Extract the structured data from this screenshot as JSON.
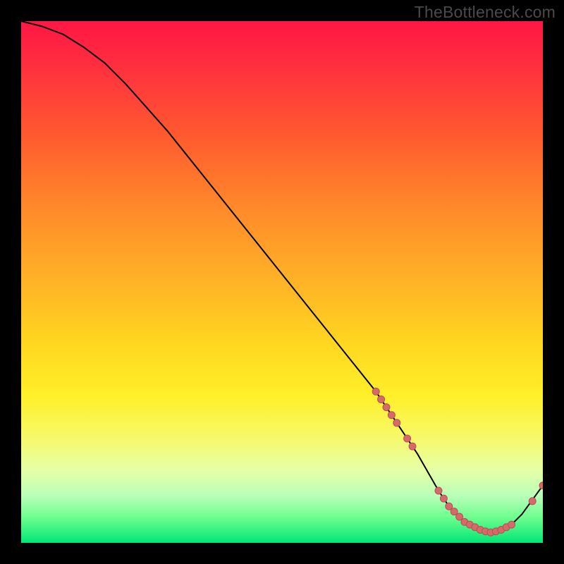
{
  "watermark": "TheBottleneck.com",
  "colors": {
    "page_bg": "#000000",
    "watermark": "#4a4a4a",
    "curve_stroke": "#000000",
    "marker_fill": "#d46a6a",
    "marker_stroke": "#b94f4f"
  },
  "chart_data": {
    "type": "line",
    "title": "",
    "xlabel": "",
    "ylabel": "",
    "xlim": [
      0,
      100
    ],
    "ylim": [
      0,
      100
    ],
    "grid": false,
    "legend": false,
    "series": [
      {
        "name": "bottleneck-curve",
        "x": [
          0,
          4,
          8,
          12,
          16,
          20,
          24,
          28,
          32,
          36,
          40,
          44,
          48,
          52,
          56,
          60,
          64,
          68,
          70,
          72,
          74,
          76,
          78,
          80,
          82,
          84,
          86,
          88,
          90,
          92,
          94,
          96,
          100
        ],
        "y": [
          100,
          99,
          97.5,
          95,
          92,
          88,
          83.5,
          79,
          74,
          69,
          64,
          59,
          54,
          49,
          44,
          39,
          34,
          29,
          26,
          23,
          20,
          17,
          13.5,
          10,
          7,
          5,
          3.5,
          2.5,
          2,
          2.5,
          3.5,
          5.5,
          11
        ]
      }
    ],
    "markers": {
      "name": "highlight-points",
      "points": [
        {
          "x": 68,
          "y": 29
        },
        {
          "x": 69,
          "y": 27.5
        },
        {
          "x": 70,
          "y": 26
        },
        {
          "x": 71,
          "y": 24.5
        },
        {
          "x": 72,
          "y": 23
        },
        {
          "x": 74,
          "y": 20
        },
        {
          "x": 75,
          "y": 18.5
        },
        {
          "x": 80,
          "y": 10
        },
        {
          "x": 81,
          "y": 8.5
        },
        {
          "x": 82,
          "y": 7
        },
        {
          "x": 83,
          "y": 6
        },
        {
          "x": 84,
          "y": 5
        },
        {
          "x": 85,
          "y": 4
        },
        {
          "x": 86,
          "y": 3.5
        },
        {
          "x": 87,
          "y": 3
        },
        {
          "x": 88,
          "y": 2.5
        },
        {
          "x": 89,
          "y": 2.2
        },
        {
          "x": 90,
          "y": 2
        },
        {
          "x": 91,
          "y": 2.2
        },
        {
          "x": 92,
          "y": 2.5
        },
        {
          "x": 93,
          "y": 3
        },
        {
          "x": 94,
          "y": 3.5
        },
        {
          "x": 98,
          "y": 8
        },
        {
          "x": 100,
          "y": 11
        }
      ]
    }
  }
}
